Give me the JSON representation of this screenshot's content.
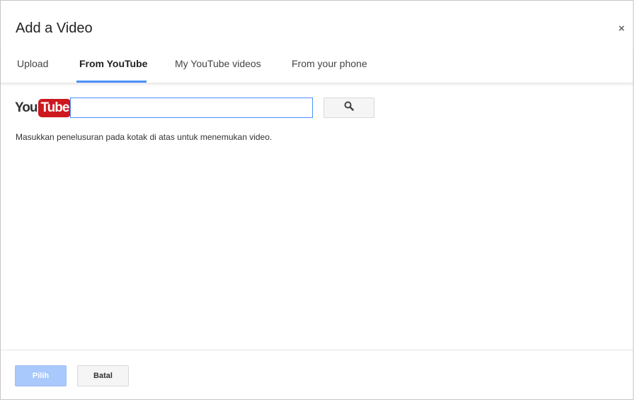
{
  "dialog": {
    "title": "Add a Video",
    "close_symbol": "×"
  },
  "tabs": [
    {
      "label": "Upload",
      "active": false
    },
    {
      "label": "From YouTube",
      "active": true
    },
    {
      "label": "My YouTube videos",
      "active": false
    },
    {
      "label": "From your phone",
      "active": false
    }
  ],
  "search": {
    "logo_you": "You",
    "logo_tube": "Tube",
    "value": "",
    "placeholder": "",
    "button_icon": "search-icon"
  },
  "hint": "Masukkan penelusuran pada kotak di atas untuk menemukan video.",
  "footer": {
    "select_label": "Pilih",
    "cancel_label": "Batal"
  },
  "colors": {
    "accent": "#4d90fe",
    "youtube_red": "#cc181e",
    "disabled_primary": "#a9c8fb"
  }
}
